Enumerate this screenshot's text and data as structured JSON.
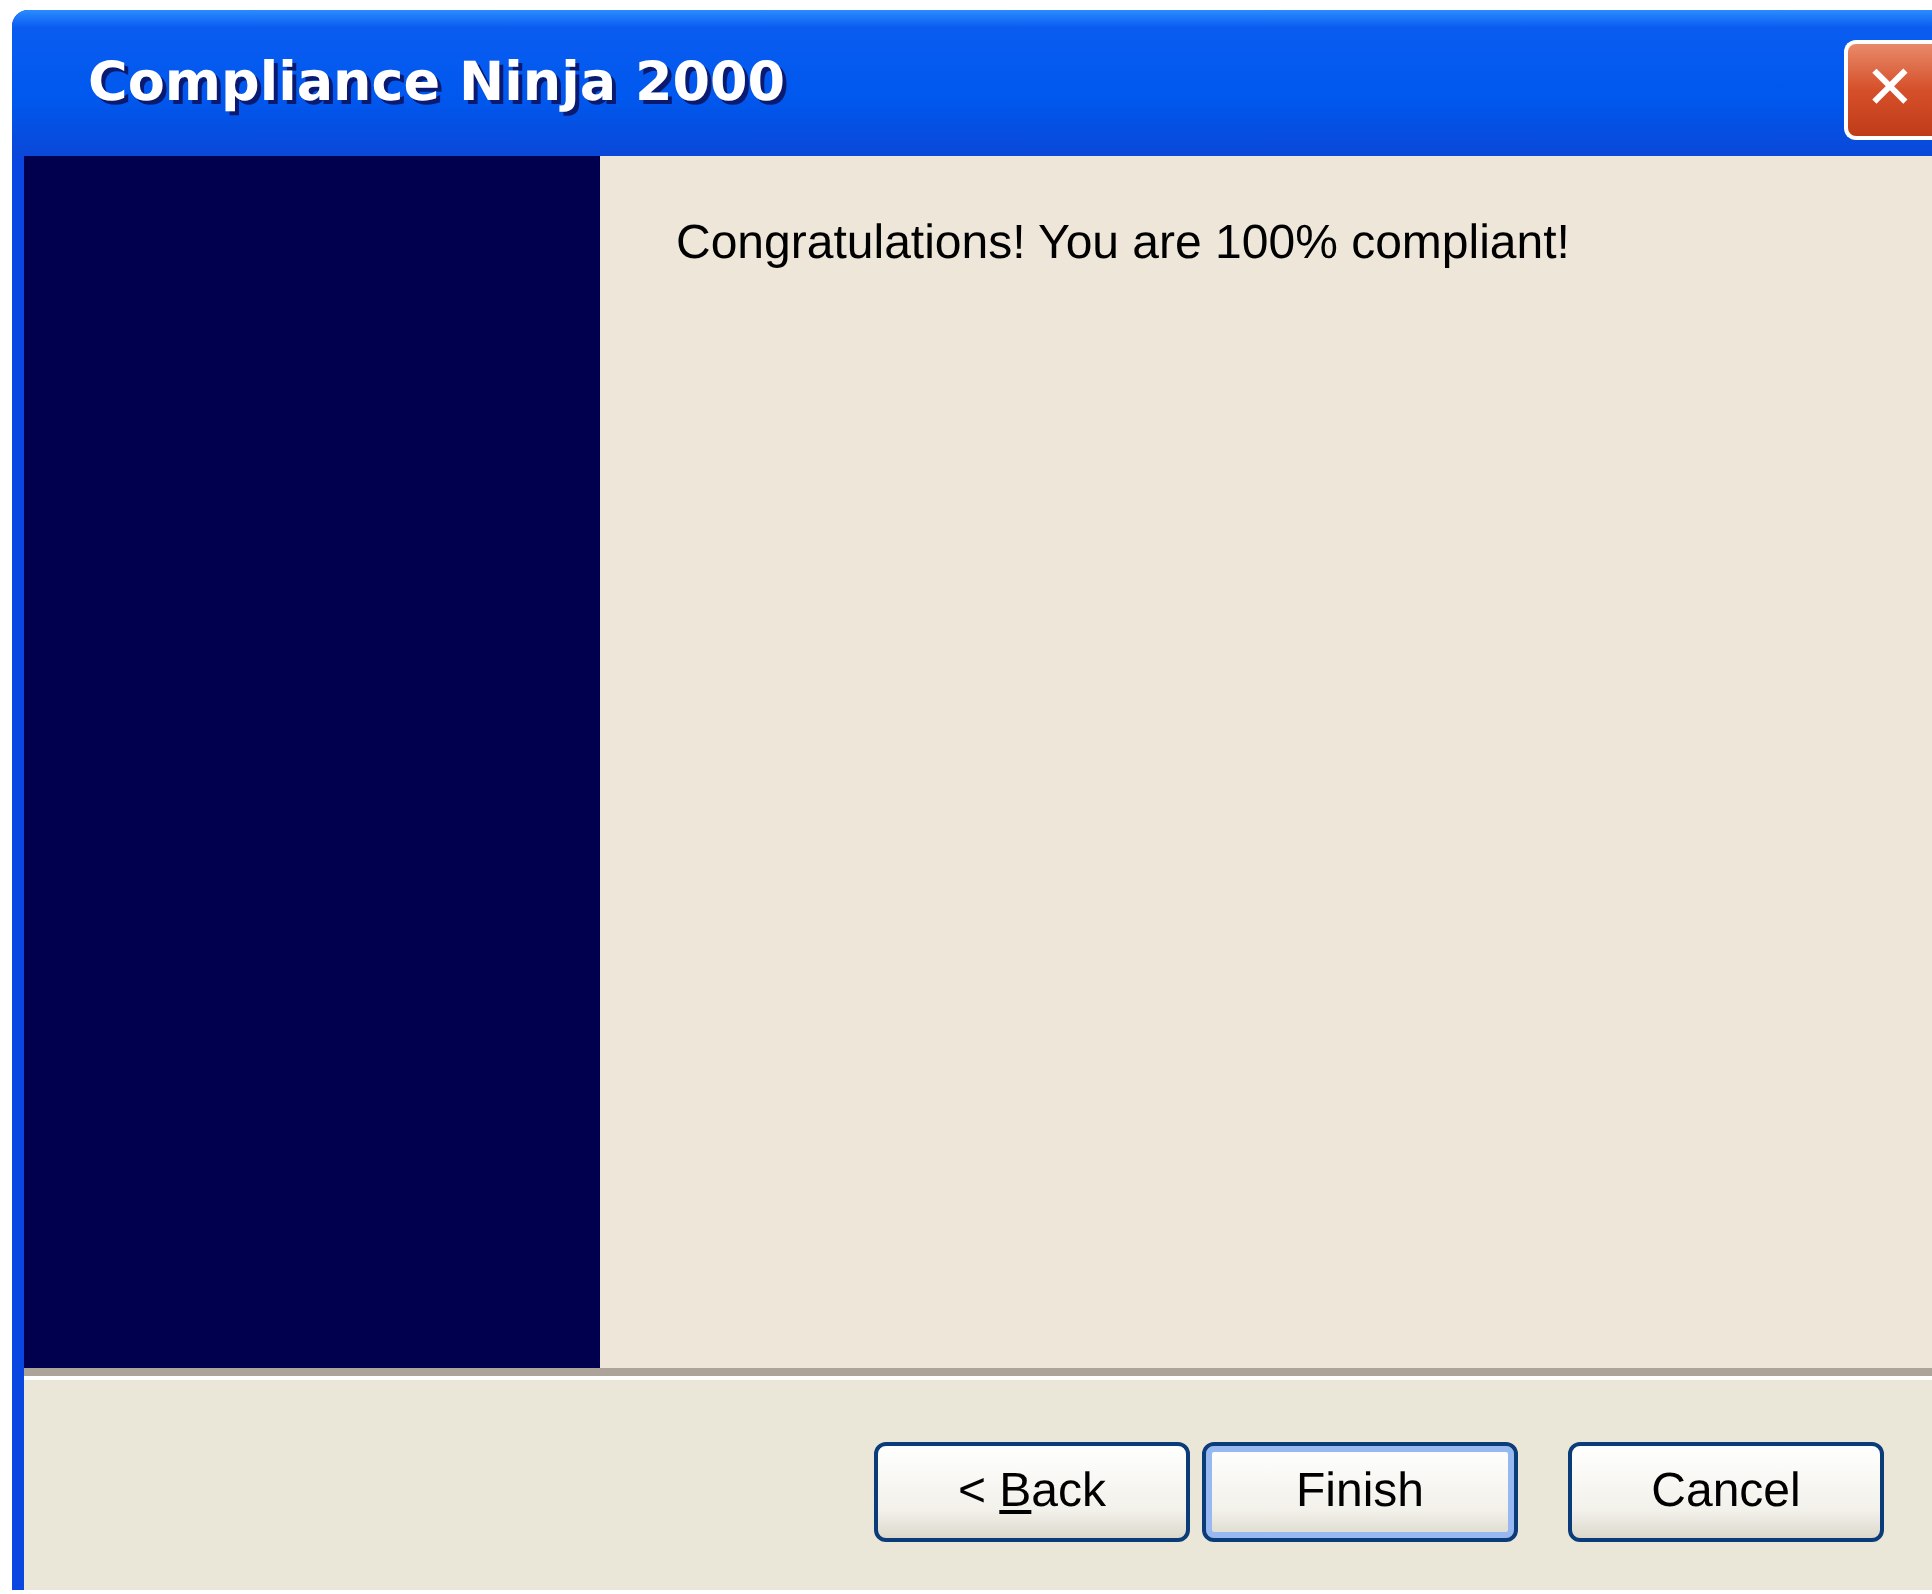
{
  "window": {
    "title": "Compliance Ninja 2000",
    "close_symbol": "✕"
  },
  "message": "Congratulations! You are 100% compliant!",
  "buttons": [
    {
      "before": "< ",
      "accelerator": "B",
      "after": "ack",
      "default": false
    },
    {
      "before": "Finish",
      "default": true
    },
    {
      "before": "Cancel",
      "default": false
    }
  ]
}
